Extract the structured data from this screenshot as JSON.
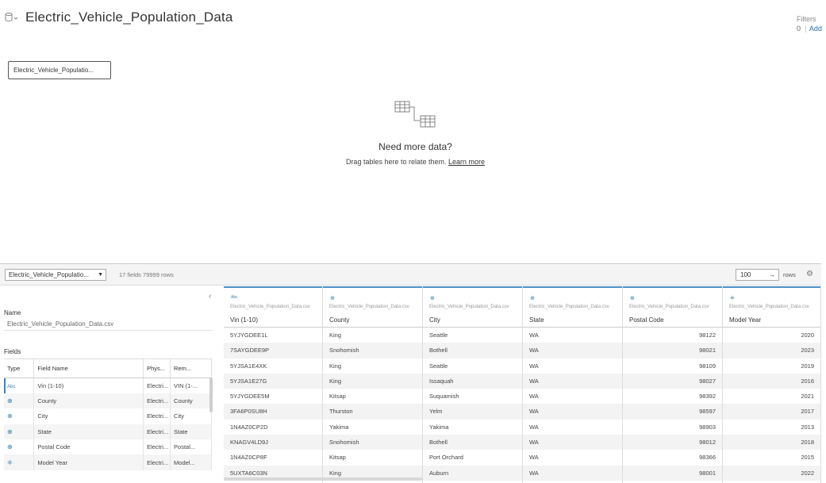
{
  "header": {
    "title": "Electric_Vehicle_Population_Data",
    "filters_label": "Filters",
    "filters_count": "0",
    "filters_add": "Add"
  },
  "canvas": {
    "table_pill": "Electric_Vehicle_Populatio...",
    "need_more": "Need more data?",
    "drag_text": "Drag tables here to relate them.",
    "learn_more": "Learn more"
  },
  "bottom_bar": {
    "table_select": "Electric_Vehicle_Populatio...",
    "fields_info": "17 fields 79999 rows",
    "rows_value": "100",
    "rows_label": "rows"
  },
  "left_panel": {
    "name_label": "Name",
    "name_value": "Electric_Vehicle_Population_Data.csv",
    "fields_label": "Fields",
    "columns": [
      "Type",
      "Field Name",
      "Phys...",
      "Rem..."
    ],
    "rows": [
      {
        "type": "Abc",
        "field": "Vin (1-10)",
        "phys": "Electri...",
        "rem": "VIN (1-..."
      },
      {
        "type": "globe",
        "field": "County",
        "phys": "Electri...",
        "rem": "County"
      },
      {
        "type": "globe",
        "field": "City",
        "phys": "Electri...",
        "rem": "City"
      },
      {
        "type": "globe",
        "field": "State",
        "phys": "Electri...",
        "rem": "State"
      },
      {
        "type": "globe",
        "field": "Postal Code",
        "phys": "Electri...",
        "rem": "Postal..."
      },
      {
        "type": "date",
        "field": "Model Year",
        "phys": "Electri...",
        "rem": "Model..."
      }
    ]
  },
  "grid": {
    "columns": [
      {
        "icon": "Abc",
        "source": "Electric_Vehicle_Population_Data.csv",
        "name": "Vin (1-10)"
      },
      {
        "icon": "globe",
        "source": "Electric_Vehicle_Population_Data.csv",
        "name": "County"
      },
      {
        "icon": "globe",
        "source": "Electric_Vehicle_Population_Data.csv",
        "name": "City"
      },
      {
        "icon": "globe",
        "source": "Electric_Vehicle_Population_Data.csv",
        "name": "State"
      },
      {
        "icon": "globe",
        "source": "Electric_Vehicle_Population_Data.csv",
        "name": "Postal Code"
      },
      {
        "icon": "date",
        "source": "Electric_Vehicle_Population_Data.csv",
        "name": "Model Year"
      }
    ],
    "rows": [
      [
        "5YJYGDEE1L",
        "King",
        "Seattle",
        "WA",
        "98122",
        "2020"
      ],
      [
        "7SAYGDEE9P",
        "Snohomish",
        "Bothell",
        "WA",
        "98021",
        "2023"
      ],
      [
        "5YJSA1E4XK",
        "King",
        "Seattle",
        "WA",
        "98109",
        "2019"
      ],
      [
        "5YJSA1E27G",
        "King",
        "Issaquah",
        "WA",
        "98027",
        "2016"
      ],
      [
        "5YJYGDEE5M",
        "Kitsap",
        "Suquamish",
        "WA",
        "98392",
        "2021"
      ],
      [
        "3FA6P0SU8H",
        "Thurston",
        "Yelm",
        "WA",
        "98597",
        "2017"
      ],
      [
        "1N4AZ0CP2D",
        "Yakima",
        "Yakima",
        "WA",
        "98903",
        "2013"
      ],
      [
        "KNAGV4LD9J",
        "Snohomish",
        "Bothell",
        "WA",
        "98012",
        "2018"
      ],
      [
        "1N4AZ0CP8F",
        "Kitsap",
        "Port Orchard",
        "WA",
        "98366",
        "2015"
      ],
      [
        "5UXTA6C03N",
        "King",
        "Auburn",
        "WA",
        "98001",
        "2022"
      ]
    ]
  }
}
